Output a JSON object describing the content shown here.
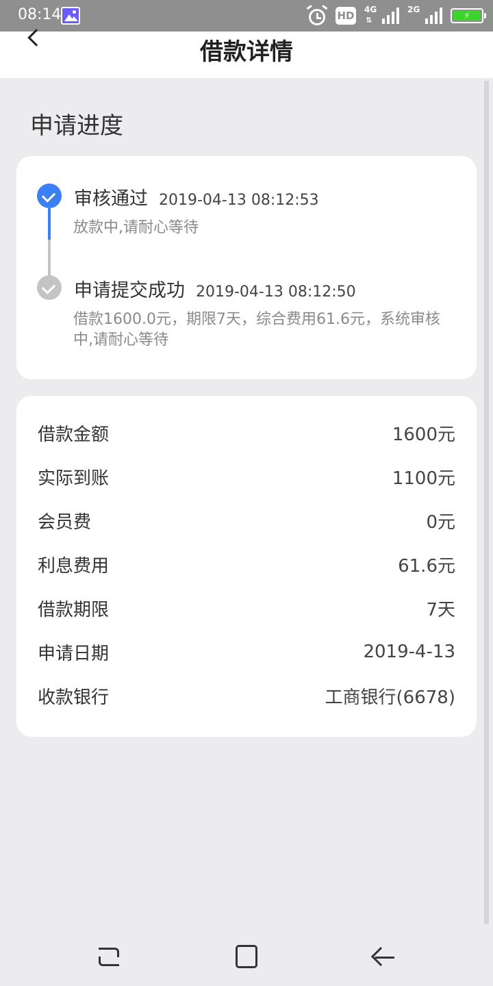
{
  "status_bar": {
    "time": "08:14",
    "hd_label": "HD",
    "net1_label": "4G",
    "net2_label": "2G",
    "battery_icon": "battery-charging-icon",
    "battery_color": "#3ad42b"
  },
  "header": {
    "title": "借款详情",
    "back_icon": "chevron-left-icon"
  },
  "progress": {
    "section_title": "申请进度",
    "steps": [
      {
        "title": "审核通过",
        "time": "2019-04-13 08:12:53",
        "desc": "放款中,请耐心等待",
        "status_color": "#3b7ff5"
      },
      {
        "title": "申请提交成功",
        "time": "2019-04-13 08:12:50",
        "desc": "借款1600.0元，期限7天，综合费用61.6元，系统审核中,请耐心等待",
        "status_color": "#c4c4c4"
      }
    ]
  },
  "details": {
    "rows": [
      {
        "label": "借款金额",
        "value": "1600元"
      },
      {
        "label": "实际到账",
        "value": "1100元"
      },
      {
        "label": "会员费",
        "value": "0元"
      },
      {
        "label": "利息费用",
        "value": "61.6元"
      },
      {
        "label": "借款期限",
        "value": "7天"
      },
      {
        "label": "申请日期",
        "value": "2019-4-13"
      },
      {
        "label": "收款银行",
        "value": "工商银行(6678)"
      }
    ]
  },
  "nav_bar": {
    "icons": [
      "recent-apps-icon",
      "home-icon",
      "back-icon"
    ]
  }
}
